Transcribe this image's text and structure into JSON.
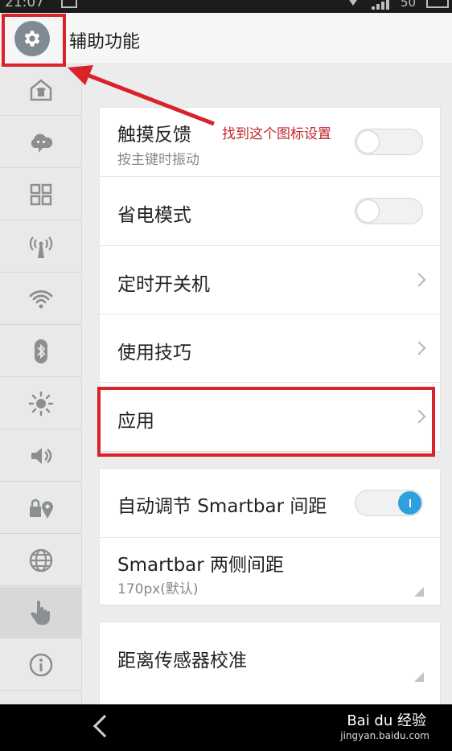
{
  "status_bar": {
    "time": "21:07",
    "battery": "50"
  },
  "header": {
    "title": "辅助功能",
    "icon": "gear-icon"
  },
  "sidebar": {
    "items": [
      {
        "icon": "theme-shirt-icon"
      },
      {
        "icon": "cloud-chat-icon"
      },
      {
        "icon": "grid-apps-icon"
      },
      {
        "icon": "antenna-icon"
      },
      {
        "icon": "wifi-icon"
      },
      {
        "icon": "bluetooth-icon"
      },
      {
        "icon": "brightness-icon"
      },
      {
        "icon": "volume-icon"
      },
      {
        "icon": "lock-location-icon"
      },
      {
        "icon": "globe-icon"
      },
      {
        "icon": "hand-pointer-icon",
        "active": true
      },
      {
        "icon": "info-icon"
      }
    ]
  },
  "card1": {
    "touch_feedback": {
      "label": "触摸反馈",
      "sub": "按主键时振动",
      "on": false
    },
    "power_save": {
      "label": "省电模式",
      "on": false
    },
    "scheduled_power": {
      "label": "定时开关机"
    },
    "tips": {
      "label": "使用技巧"
    },
    "apps": {
      "label": "应用"
    }
  },
  "card2": {
    "auto_smartbar": {
      "label": "自动调节 Smartbar 间距",
      "on": true
    },
    "smartbar_spacing": {
      "label": "Smartbar 两侧间距",
      "sub": "170px(默认)"
    }
  },
  "card3": {
    "sensor_calibration": {
      "label": "距离传感器校准"
    }
  },
  "annotation": {
    "text": "找到这个图标设置"
  },
  "colors": {
    "highlight": "#d9222a",
    "toggle_on": "#2ea0e0",
    "annotation_text": "#c1272d"
  },
  "watermark": {
    "brand": "Bai du 经验",
    "url": "jingyan.baidu.com"
  }
}
